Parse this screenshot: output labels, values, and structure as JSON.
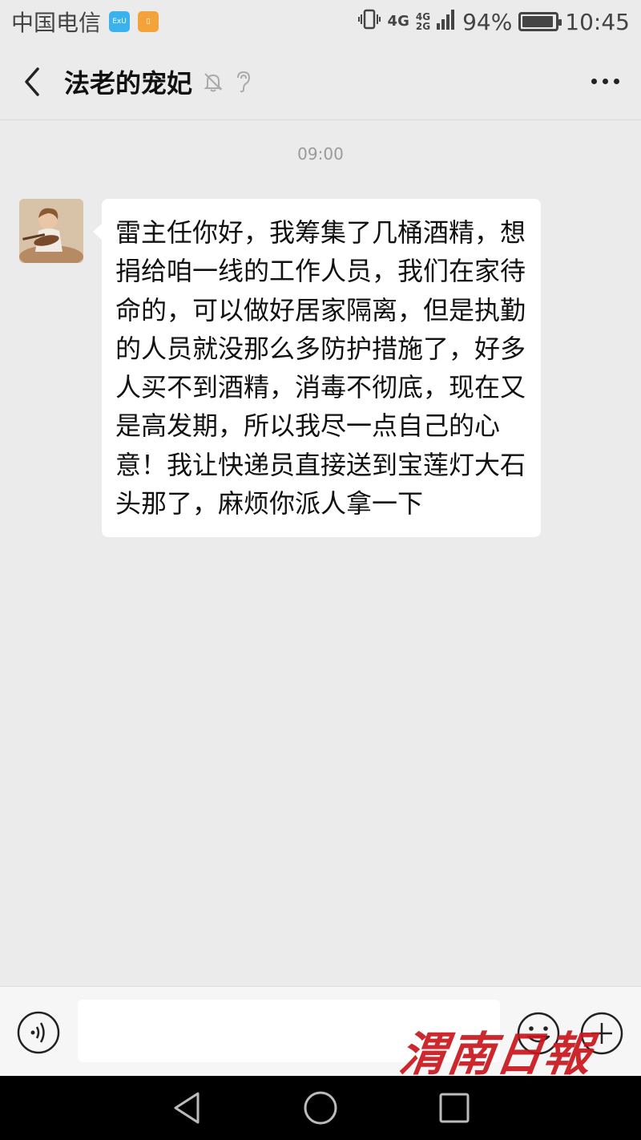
{
  "status_bar": {
    "carrier": "中国电信",
    "app_badge_1": "ExU",
    "app_badge_2": "▯",
    "network_4g": "4G",
    "network_stack_top": "4G",
    "network_stack_bottom": "2G",
    "battery_percent": "94%",
    "battery_level": 0.94,
    "time": "10:45"
  },
  "title_bar": {
    "title": "法老的宠妃",
    "icons": [
      "back-arrow-icon",
      "mute-bell-icon",
      "earpiece-icon",
      "more-icon"
    ]
  },
  "chat": {
    "timestamp": "09:00",
    "messages": [
      {
        "sender": "incoming",
        "text": "雷主任你好，我筹集了几桶酒精，想捐给咱一线的工作人员，我们在家待命的，可以做好居家隔离，但是执勤的人员就没那么多防护措施了，好多人买不到酒精，消毒不彻底，现在又是高发期，所以我尽一点自己的心意！我让快递员直接送到宝莲灯大石头那了，麻烦你派人拿一下"
      }
    ]
  },
  "input_bar": {
    "placeholder": "",
    "value": "",
    "icons": [
      "voice-icon",
      "emoji-icon",
      "plus-icon"
    ]
  },
  "watermark": "渭南日報",
  "nav_bar": {
    "icons": [
      "back-triangle-icon",
      "home-circle-icon",
      "recents-square-icon"
    ]
  },
  "colors": {
    "background": "#ebebeb",
    "bubble": "#ffffff",
    "watermark": "#c8161d"
  }
}
